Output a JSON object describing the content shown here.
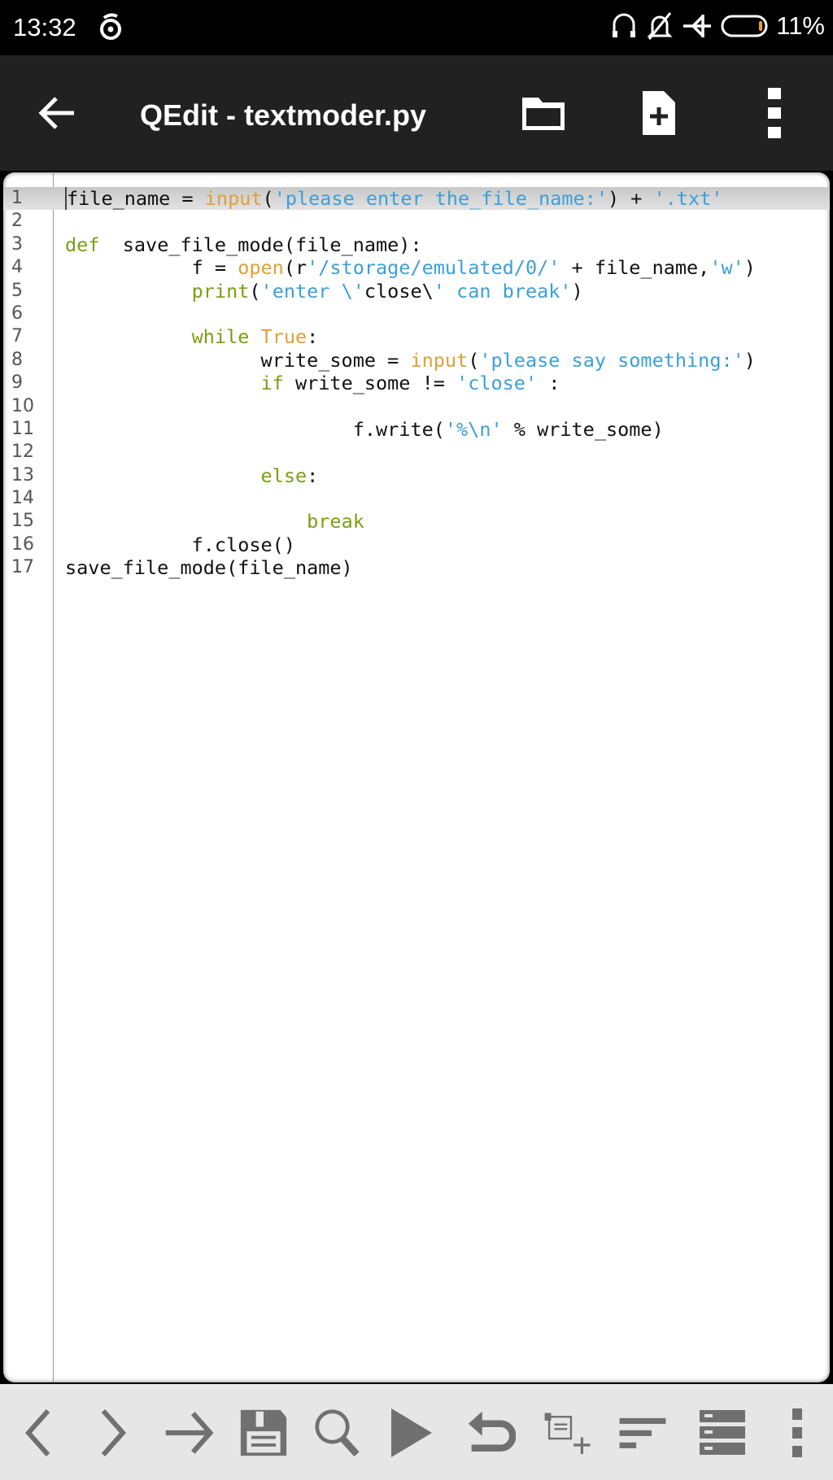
{
  "status_bar": {
    "time": "13:32",
    "battery": "11%",
    "icons": [
      "headset-icon",
      "bell-off-icon",
      "airplane-icon",
      "battery-icon"
    ]
  },
  "toolbar": {
    "title": "QEdit - textmoder.py",
    "icons": [
      "back-arrow-icon",
      "folder-icon",
      "new-file-icon",
      "more-vert-icon"
    ]
  },
  "colors": {
    "keyword": "#7a9f12",
    "builtin": "#e0a03a",
    "string": "#3c9fd8",
    "toolbar": "#212121",
    "bottom_bar": "#e6e6e6",
    "icon": "#707070"
  },
  "editor": {
    "current_line": 1,
    "lines": [
      [
        [
          "file_name = ",
          "plain"
        ],
        [
          "input",
          "fn"
        ],
        [
          "(",
          "plain"
        ],
        [
          "'please enter the_file_name:'",
          "str"
        ],
        [
          ") + ",
          "plain"
        ],
        [
          "'.txt'",
          "str"
        ]
      ],
      [],
      [
        [
          "def",
          "kw"
        ],
        [
          "  save_file_mode(file_name):",
          "plain"
        ]
      ],
      [
        [
          "           f = ",
          "plain"
        ],
        [
          "open",
          "fn"
        ],
        [
          "(r",
          "plain"
        ],
        [
          "'/storage/emulated/0/'",
          "str"
        ],
        [
          " + file_name,",
          "plain"
        ],
        [
          "'w'",
          "str"
        ],
        [
          ")",
          "plain"
        ]
      ],
      [
        [
          "           ",
          "plain"
        ],
        [
          "print",
          "kw"
        ],
        [
          "(",
          "plain"
        ],
        [
          "'enter \\'",
          "str"
        ],
        [
          "close\\",
          "plain"
        ],
        [
          "' can break'",
          "str"
        ],
        [
          ")",
          "plain"
        ]
      ],
      [],
      [
        [
          "           ",
          "plain"
        ],
        [
          "while",
          "kw"
        ],
        [
          " ",
          "plain"
        ],
        [
          "True",
          "fn"
        ],
        [
          ":",
          "plain"
        ]
      ],
      [
        [
          "                 write_some = ",
          "plain"
        ],
        [
          "input",
          "fn"
        ],
        [
          "(",
          "plain"
        ],
        [
          "'please say something:'",
          "str"
        ],
        [
          ")",
          "plain"
        ]
      ],
      [
        [
          "                 ",
          "plain"
        ],
        [
          "if",
          "kw"
        ],
        [
          " write_some != ",
          "plain"
        ],
        [
          "'close'",
          "str"
        ],
        [
          " :",
          "plain"
        ]
      ],
      [],
      [
        [
          "                         f.write(",
          "plain"
        ],
        [
          "'%\\n'",
          "str"
        ],
        [
          " % write_some)",
          "plain"
        ]
      ],
      [],
      [
        [
          "                 ",
          "plain"
        ],
        [
          "else",
          "kw"
        ],
        [
          ":",
          "plain"
        ]
      ],
      [],
      [
        [
          "                     ",
          "plain"
        ],
        [
          "break",
          "kw"
        ]
      ],
      [
        [
          "           f.close()",
          "plain"
        ]
      ],
      [
        [
          "save_file_mode(file_name)",
          "plain"
        ]
      ]
    ]
  },
  "bottom_bar": {
    "icons": [
      "chevron-left-icon",
      "chevron-right-icon",
      "arrow-right-icon",
      "save-icon",
      "search-icon",
      "run-icon",
      "undo-icon",
      "add-tab-icon",
      "format-icon",
      "list-icon",
      "more-vert-icon"
    ]
  }
}
